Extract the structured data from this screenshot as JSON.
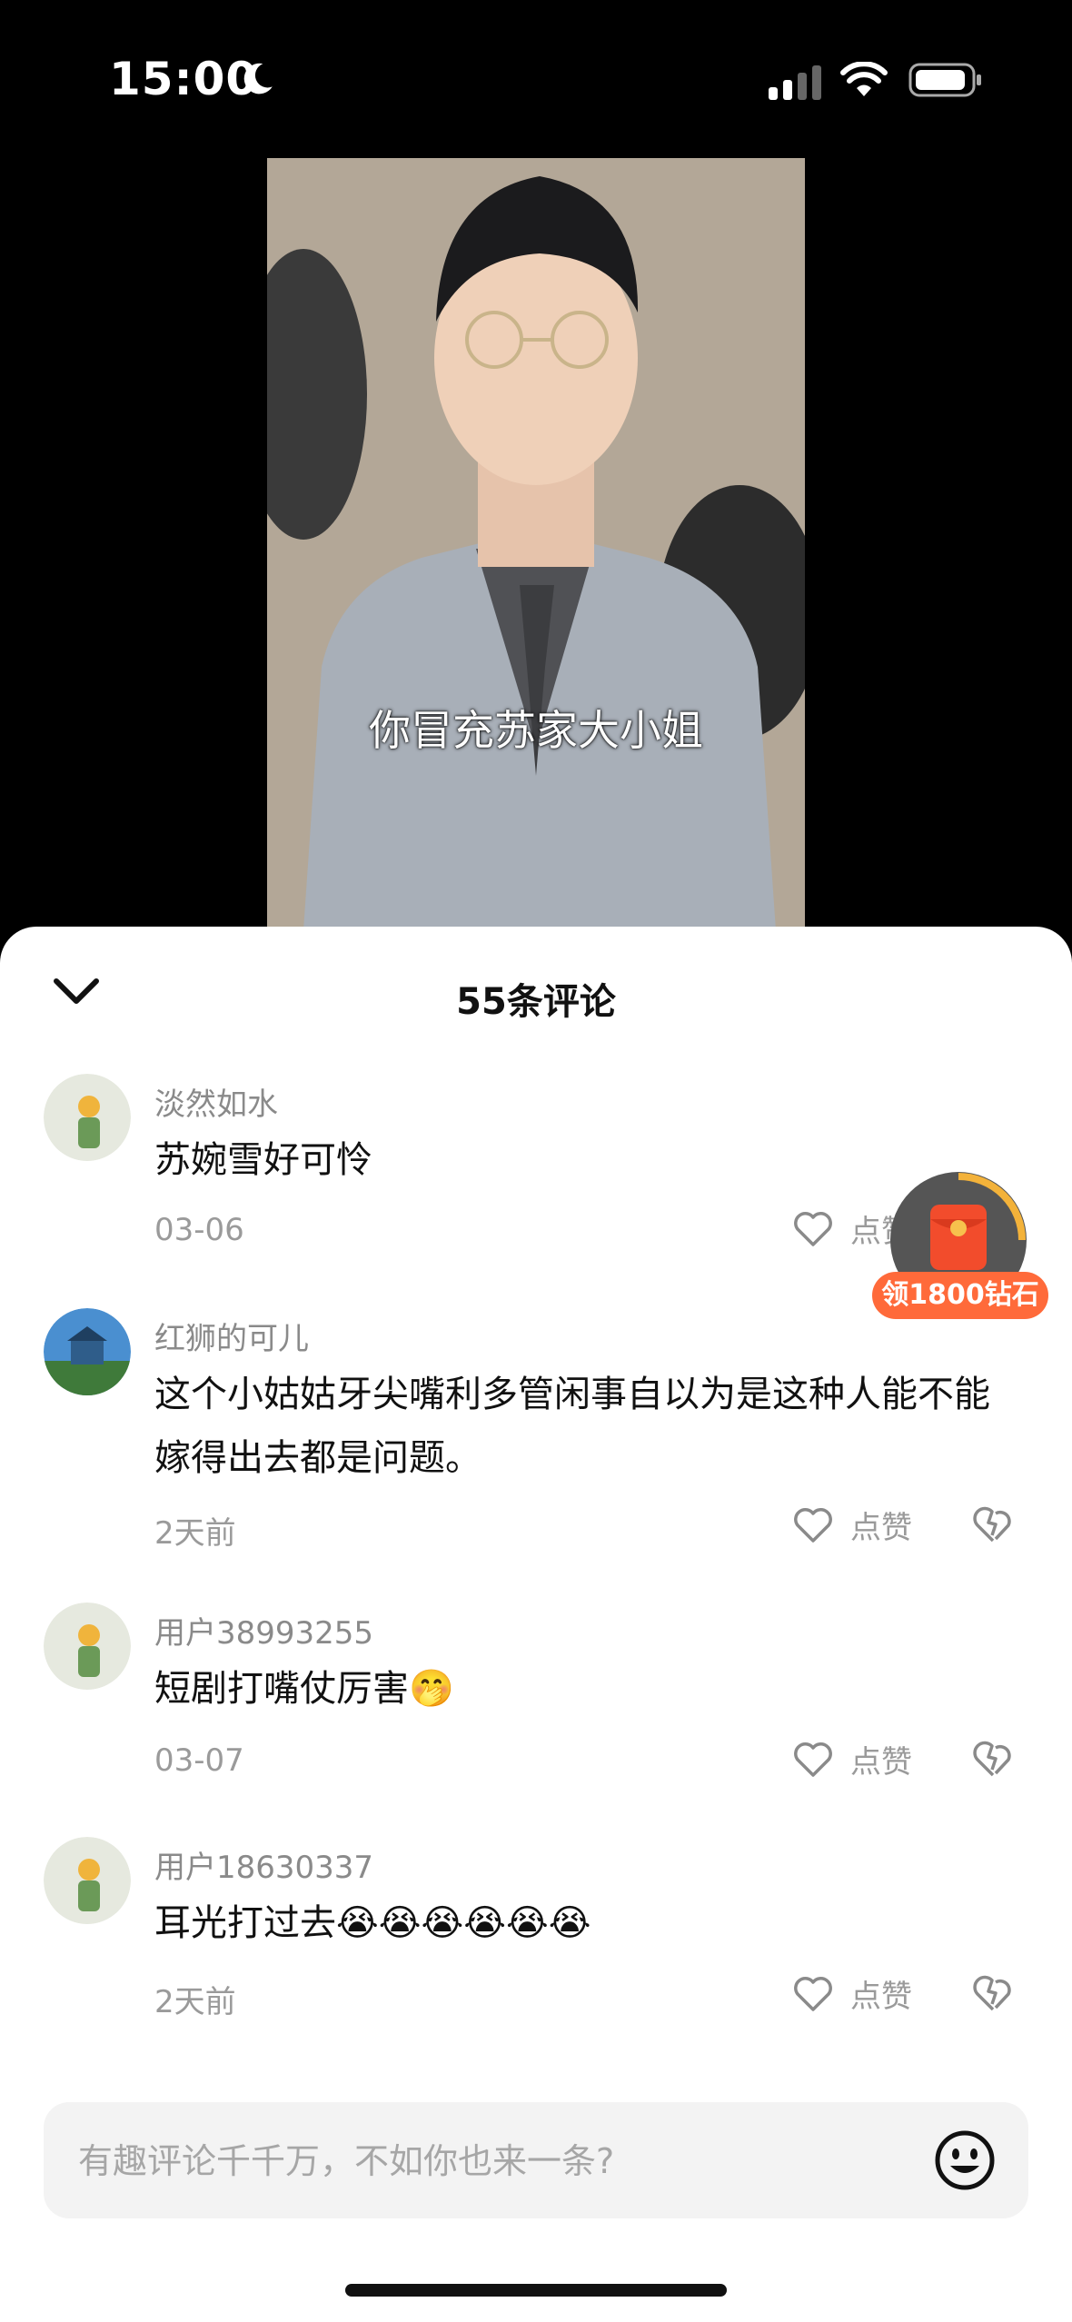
{
  "status": {
    "time": "15:00"
  },
  "video": {
    "subtitle": "你冒充苏家大小姐"
  },
  "sheet": {
    "title": "55条评论"
  },
  "comments": [
    {
      "user": "淡然如水",
      "text": "苏婉雪好可怜",
      "time": "03-06",
      "like_label": "点赞"
    },
    {
      "user": "红狮的可儿",
      "text": "这个小姑姑牙尖嘴利多管闲事自以为是这种人能不能嫁得出去都是问题。",
      "time": "2天前",
      "like_label": "点赞"
    },
    {
      "user": "用户38993255",
      "text": "短剧打嘴仗厉害🤭",
      "time": "03-07",
      "like_label": "点赞"
    },
    {
      "user": "用户18630337",
      "text": "耳光打过去😭😭😭😭😭😭",
      "time": "2天前",
      "like_label": "点赞"
    }
  ],
  "red_packet": {
    "label": "领1800钻石"
  },
  "input": {
    "placeholder": "有趣评论千千万，不如你也来一条?"
  }
}
